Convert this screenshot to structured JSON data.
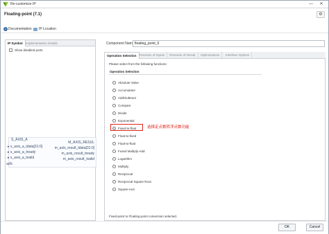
{
  "window": {
    "title": "Re-customize IP",
    "minimize": "—",
    "close": "✕"
  },
  "header": {
    "ip_name": "Floating-point (7.1)",
    "settings_icon": "gear-icon",
    "settings_glyph": "⚙"
  },
  "links": {
    "documentation": "Documentation",
    "ip_location": "IP Location"
  },
  "left_panel": {
    "tabs": [
      "IP Symbol",
      "Implementation Details"
    ],
    "show_disabled_ports": "Show disabled ports",
    "symbol": {
      "left_ports": [
        "S_AXIS_A",
        "s_axis_a_tdata[31:0]",
        "s_axis_a_tready",
        "s_axis_a_tvalid",
        "aclk"
      ],
      "right_ports": [
        "M_AXIS_RESUL",
        "m_axis_result_tdata[31:0]",
        "m_axis_result_tready",
        "m_axis_result_tvalid"
      ]
    }
  },
  "right_panel": {
    "component_name_label": "Component Name",
    "component_name_value": "floating_point_0",
    "tabs": [
      "Operation Selection",
      "Precision of Inputs",
      "Precision of Result",
      "Optimizations",
      "Interface Options"
    ],
    "instruction": "Please select from the following functions:",
    "group_label": "Operation Selection",
    "options": [
      "Absolute Value",
      "Accumulator",
      "Add/Subtract",
      "Compare",
      "Divide",
      "Exponential",
      "Fixed-to-float",
      "Float-to-fixed",
      "Float-to-float",
      "Fused Multiply-Add",
      "Logarithm",
      "Multiply",
      "Reciprocal",
      "Reciprocal Square Root",
      "Square-root"
    ],
    "selected_option": "Fixed-to-float",
    "annotation": "选择定点数转浮点数功能",
    "status": "Fixed-point to Floating-point conversion selected."
  },
  "footer": {
    "ok": "OK",
    "cancel": "Cancel"
  },
  "colors": {
    "annotation_red": "#e0241b",
    "tab_bg": "#eef0f3",
    "port_text": "#3a4a66"
  }
}
